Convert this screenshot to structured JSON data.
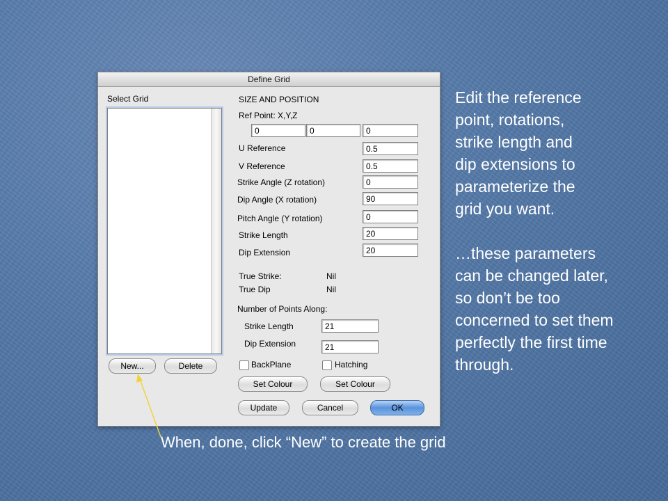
{
  "dialog": {
    "title": "Define Grid",
    "select_grid_label": "Select Grid",
    "section_title": "SIZE AND POSITION",
    "ref_point_label": "Ref Point: X,Y,Z",
    "ref_point_values": [
      "0",
      "0",
      "0"
    ],
    "params": [
      {
        "label": "U Reference",
        "value": "0.5"
      },
      {
        "label": "V Reference",
        "value": "0.5"
      },
      {
        "label": "Strike Angle (Z rotation)",
        "value": "0"
      },
      {
        "label": "Dip Angle (X rotation)",
        "value": "90"
      },
      {
        "label": "Pitch Angle (Y rotation)",
        "value": "0"
      },
      {
        "label": "Strike Length",
        "value": "20"
      },
      {
        "label": "Dip Extension",
        "value": "20"
      }
    ],
    "true_strike_label": "True Strike:",
    "true_strike_value": "Nil",
    "true_dip_label": "True Dip",
    "true_dip_value": "Nil",
    "points_along_label": "Number of  Points Along:",
    "points_strike_label": "Strike Length",
    "points_strike_value": "21",
    "points_dip_label": "Dip Extension",
    "points_dip_value": "21",
    "new_button": "New...",
    "delete_button": "Delete",
    "backplane_label": "BackPlane",
    "hatching_label": "Hatching",
    "set_colour_1": "Set Colour",
    "set_colour_2": "Set Colour",
    "update_button": "Update",
    "cancel_button": "Cancel",
    "ok_button": "OK"
  },
  "caption_lines": [
    "Edit the reference",
    "point, rotations,",
    "strike length and",
    "dip extensions to",
    "parameterize the",
    "grid you want.",
    "",
    "…these parameters",
    "can be changed later,",
    "so don’t be too",
    "concerned to set them",
    "perfectly the first time",
    "through."
  ],
  "bottom_caption": "When, done, click “New” to create the grid",
  "colors": {
    "background": "#5479a8",
    "arrow": "#f2d23c",
    "default_button": "#5a93dc"
  }
}
